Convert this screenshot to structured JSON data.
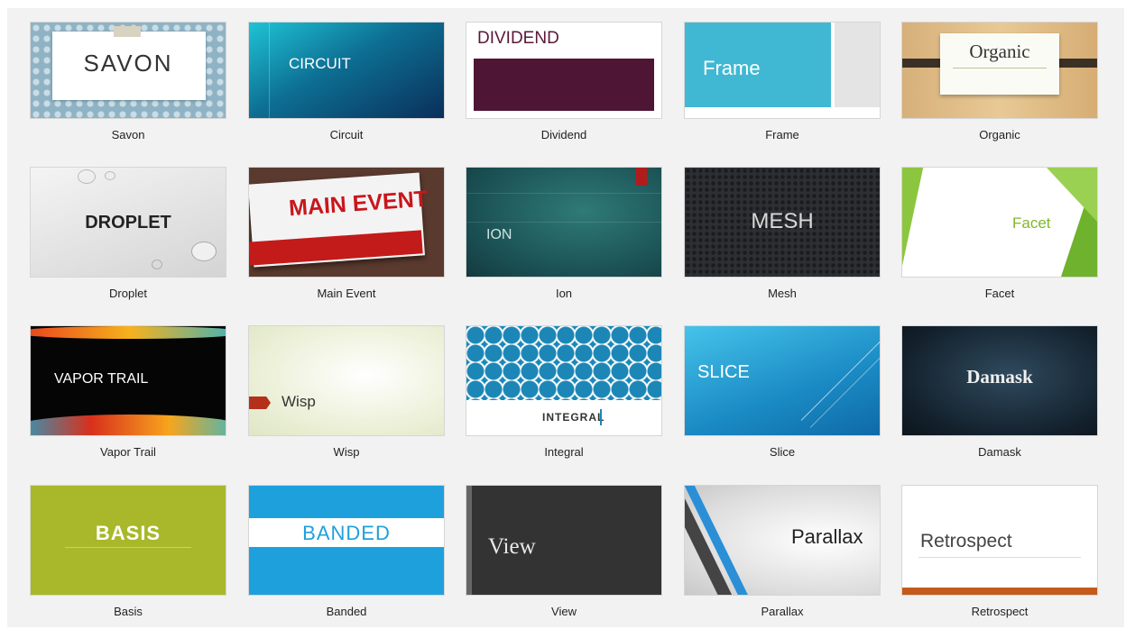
{
  "themes": [
    {
      "name": "Savon",
      "title": "SAVON"
    },
    {
      "name": "Circuit",
      "title": "CIRCUIT"
    },
    {
      "name": "Dividend",
      "title": "DIVIDEND"
    },
    {
      "name": "Frame",
      "title": "Frame"
    },
    {
      "name": "Organic",
      "title": "Organic"
    },
    {
      "name": "Droplet",
      "title": "DROPLET"
    },
    {
      "name": "Main Event",
      "title": "MAIN EVENT"
    },
    {
      "name": "Ion",
      "title": "ION"
    },
    {
      "name": "Mesh",
      "title": "MESH"
    },
    {
      "name": "Facet",
      "title": "Facet"
    },
    {
      "name": "Vapor Trail",
      "title": "VAPOR TRAIL"
    },
    {
      "name": "Wisp",
      "title": "Wisp"
    },
    {
      "name": "Integral",
      "title": "INTEGRAL"
    },
    {
      "name": "Slice",
      "title": "SLICE"
    },
    {
      "name": "Damask",
      "title": "Damask"
    },
    {
      "name": "Basis",
      "title": "BASIS"
    },
    {
      "name": "Banded",
      "title": "BANDED"
    },
    {
      "name": "View",
      "title": "View"
    },
    {
      "name": "Parallax",
      "title": "Parallax"
    },
    {
      "name": "Retrospect",
      "title": "Retrospect"
    }
  ]
}
